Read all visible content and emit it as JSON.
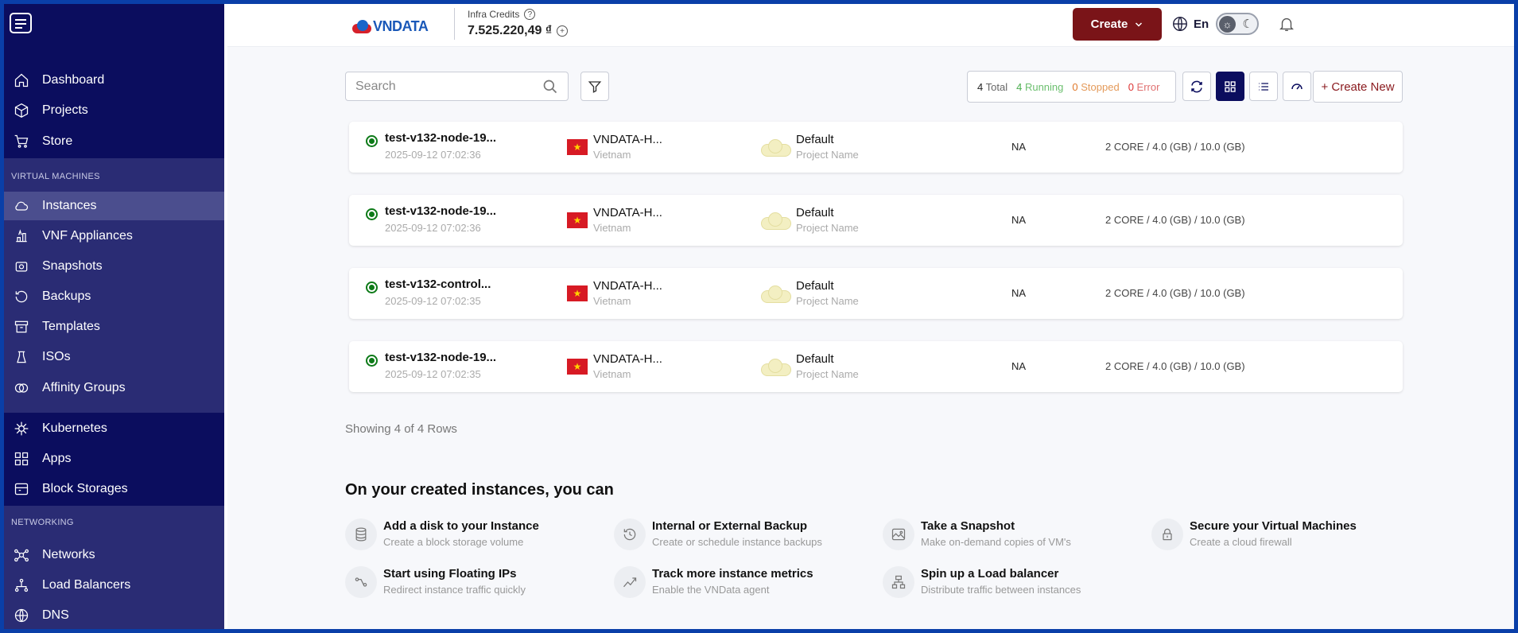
{
  "sidebar": {
    "top_items": [
      {
        "label": "Dashboard",
        "icon": "home-icon"
      },
      {
        "label": "Projects",
        "icon": "cube-icon"
      },
      {
        "label": "Store",
        "icon": "cart-icon"
      }
    ],
    "vm_section": "VIRTUAL MACHINES",
    "vm_items": [
      {
        "label": "Instances",
        "icon": "cloud-icon",
        "active": true
      },
      {
        "label": "VNF Appliances",
        "icon": "appliance-icon"
      },
      {
        "label": "Snapshots",
        "icon": "snapshot-icon"
      },
      {
        "label": "Backups",
        "icon": "backup-icon"
      },
      {
        "label": "Templates",
        "icon": "template-icon"
      },
      {
        "label": "ISOs",
        "icon": "iso-icon"
      },
      {
        "label": "Affinity Groups",
        "icon": "affinity-icon"
      }
    ],
    "k8s_items": [
      {
        "label": "Kubernetes",
        "icon": "kubernetes-icon"
      },
      {
        "label": "Apps",
        "icon": "apps-icon"
      },
      {
        "label": "Block Storages",
        "icon": "block-storage-icon"
      }
    ],
    "net_section": "NETWORKING",
    "net_items": [
      {
        "label": "Networks",
        "icon": "network-icon"
      },
      {
        "label": "Load Balancers",
        "icon": "load-balancer-icon"
      },
      {
        "label": "DNS",
        "icon": "globe-icon"
      }
    ]
  },
  "header": {
    "brand": "VNDATA",
    "credits_label": "Infra Credits",
    "credits_value": "7.525.220,49 ₫",
    "create_label": "Create",
    "lang": "En"
  },
  "toolbar": {
    "search_placeholder": "Search",
    "total_count": "4",
    "total_label": "Total",
    "running_count": "4",
    "running_label": "Running",
    "stopped_count": "0",
    "stopped_label": "Stopped",
    "error_count": "0",
    "error_label": "Error",
    "create_new": "+ Create New"
  },
  "instances": [
    {
      "name": "test-v132-node-19...",
      "date": "2025-09-12 07:02:36",
      "datacenter": "VNDATA-H...",
      "country": "Vietnam",
      "project": "Default",
      "project_sub": "Project Name",
      "ip": "NA",
      "spec": "2 CORE / 4.0 (GB) / 10.0 (GB)"
    },
    {
      "name": "test-v132-node-19...",
      "date": "2025-09-12 07:02:36",
      "datacenter": "VNDATA-H...",
      "country": "Vietnam",
      "project": "Default",
      "project_sub": "Project Name",
      "ip": "NA",
      "spec": "2 CORE / 4.0 (GB) / 10.0 (GB)"
    },
    {
      "name": "test-v132-control...",
      "date": "2025-09-12 07:02:35",
      "datacenter": "VNDATA-H...",
      "country": "Vietnam",
      "project": "Default",
      "project_sub": "Project Name",
      "ip": "NA",
      "spec": "2 CORE / 4.0 (GB) / 10.0 (GB)"
    },
    {
      "name": "test-v132-node-19...",
      "date": "2025-09-12 07:02:35",
      "datacenter": "VNDATA-H...",
      "country": "Vietnam",
      "project": "Default",
      "project_sub": "Project Name",
      "ip": "NA",
      "spec": "2 CORE / 4.0 (GB) / 10.0 (GB)"
    }
  ],
  "showing": "Showing 4 of 4 Rows",
  "tips": {
    "title": "On your created instances, you can",
    "items": [
      {
        "title": "Add a disk to your Instance",
        "sub": "Create a block storage volume",
        "icon": "database-icon"
      },
      {
        "title": "Internal or External Backup",
        "sub": "Create or schedule instance backups",
        "icon": "backup-icon"
      },
      {
        "title": "Take a Snapshot",
        "sub": "Make on-demand copies of VM's",
        "icon": "image-icon"
      },
      {
        "title": "Secure your Virtual Machines",
        "sub": "Create a cloud firewall",
        "icon": "lock-icon"
      },
      {
        "title": "Start using Floating IPs",
        "sub": "Redirect instance traffic quickly",
        "icon": "floating-ip-icon"
      },
      {
        "title": "Track more instance metrics",
        "sub": "Enable the VNData agent",
        "icon": "chart-line-icon"
      },
      {
        "title": "Spin up a Load balancer",
        "sub": "Distribute traffic between instances",
        "icon": "load-balancer-icon"
      }
    ]
  }
}
